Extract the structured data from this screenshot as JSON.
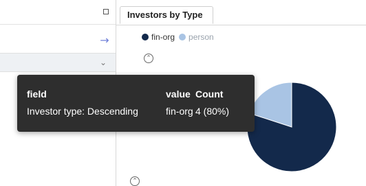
{
  "left_panel": {
    "maximize_icon": "maximize-icon",
    "navigate_arrow": "→",
    "dropdown_chevron": "⌄"
  },
  "tab": {
    "label": "Investors by Type"
  },
  "legend": [
    {
      "label": "fin-org",
      "color": "#13294b",
      "active": true
    },
    {
      "label": "person",
      "color": "#a9c4e4",
      "active": false
    }
  ],
  "collapse_glyph": "⌃",
  "tooltip": {
    "headers": [
      "field",
      "value",
      "Count"
    ],
    "row": [
      "Investor type: Descending",
      "fin-org",
      "4 (80%)"
    ]
  },
  "chart_data": {
    "type": "pie",
    "categories": [
      "fin-org",
      "person"
    ],
    "values": [
      4,
      1
    ],
    "colors": [
      "#13294b",
      "#a9c4e4"
    ]
  }
}
